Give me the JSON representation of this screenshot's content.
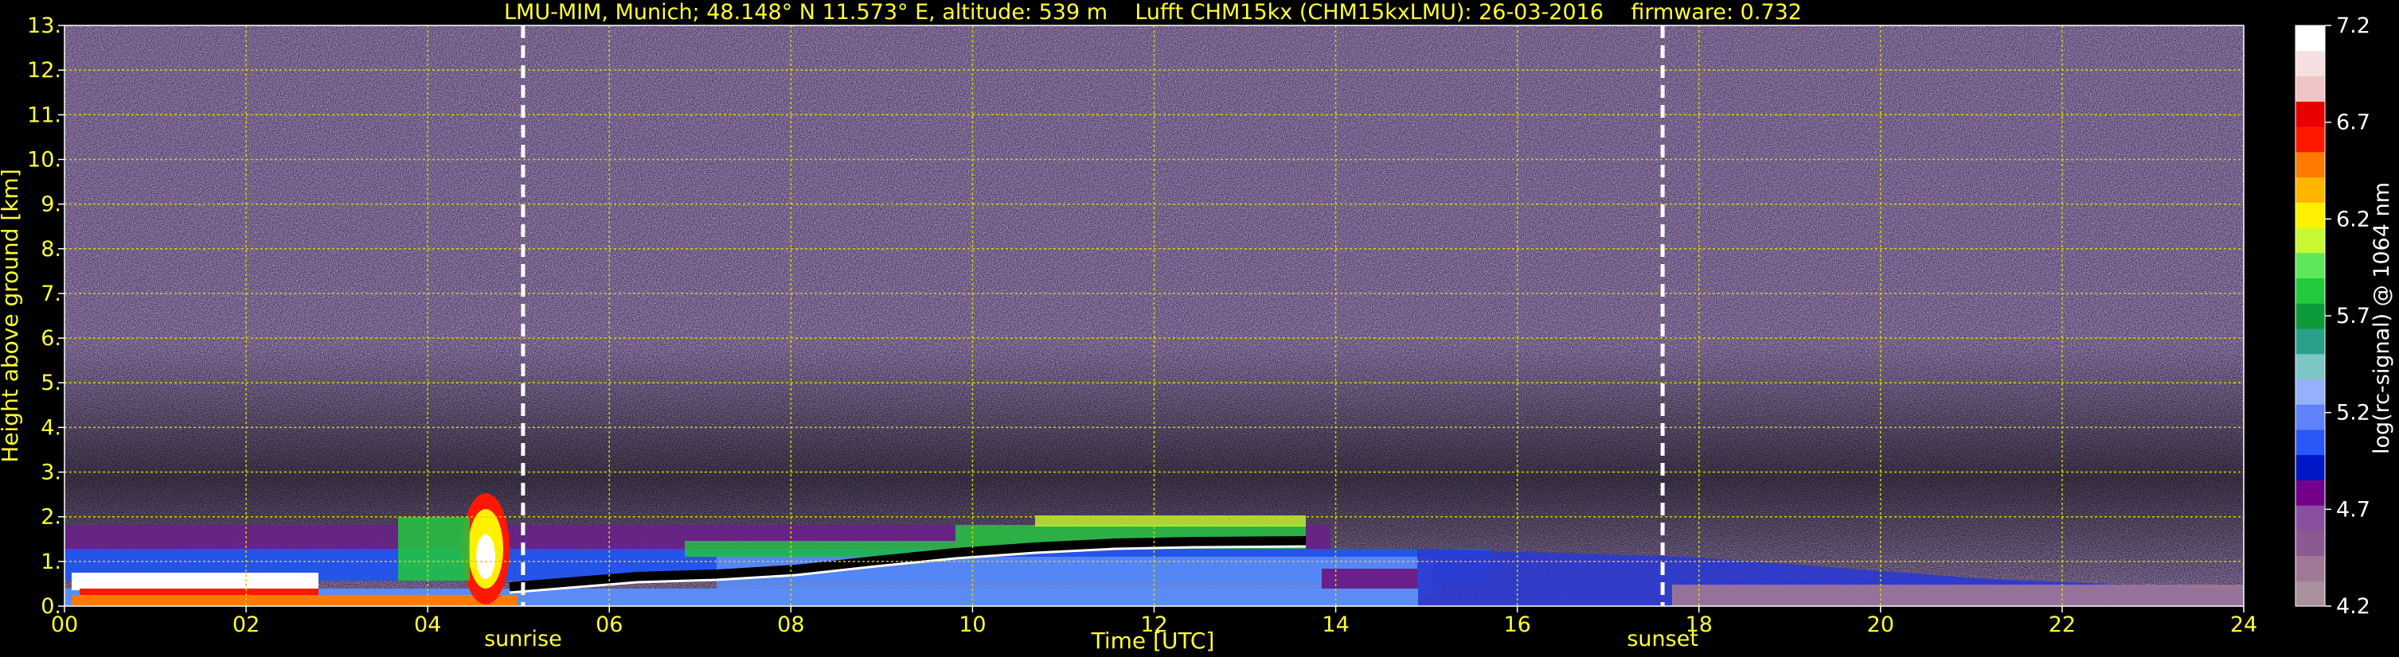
{
  "title": "LMU-MIM, Munich; 48.148° N 11.573° E, altitude: 539 m    Lufft CHM15kx (CHM15kxLMU): 26-03-2016    firmware: 0.732",
  "chart_data": {
    "type": "heatmap",
    "title": "LMU-MIM, Munich; 48.148° N 11.573° E, altitude: 539 m    Lufft CHM15kx (CHM15kxLMU): 26-03-2016    firmware: 0.732",
    "xlabel": "Time [UTC]",
    "ylabel": "Height above ground [km]",
    "xlim": [
      0,
      24
    ],
    "ylim": [
      0,
      13
    ],
    "x_ticks": [
      0,
      2,
      4,
      6,
      8,
      10,
      12,
      14,
      16,
      18,
      20,
      22,
      24
    ],
    "x_tick_labels": [
      "00",
      "02",
      "04",
      "06",
      "08",
      "10",
      "12",
      "14",
      "16",
      "18",
      "20",
      "22",
      "24"
    ],
    "y_ticks": [
      0,
      1,
      2,
      3,
      4,
      5,
      6,
      7,
      8,
      9,
      10,
      11,
      12,
      13
    ],
    "y_tick_labels": [
      "0.",
      "1.",
      "2.",
      "3.",
      "4.",
      "5.",
      "6.",
      "7.",
      "8.",
      "9.",
      "10.",
      "11.",
      "12.",
      "13."
    ],
    "grid": true,
    "annotations": [
      {
        "label": "sunrise",
        "x": 5.05
      },
      {
        "label": "sunset",
        "x": 17.6
      }
    ],
    "colorbar": {
      "label": "log(rc-signal) @ 1064 nm",
      "range": [
        4.2,
        7.2
      ],
      "ticks": [
        4.2,
        4.7,
        5.2,
        5.7,
        6.2,
        6.7,
        7.2
      ],
      "tick_labels": [
        "4.2",
        "4.7",
        "5.2",
        "5.7",
        "6.2",
        "6.7",
        "7.2"
      ],
      "colors": [
        "#a8909c",
        "#a07896",
        "#8a5a90",
        "#8b4fa0",
        "#75008a",
        "#0018c8",
        "#2858f8",
        "#5f82f8",
        "#95b1fb",
        "#7cc6c6",
        "#2aa08a",
        "#0d9a3a",
        "#22c93c",
        "#5de85b",
        "#c8f832",
        "#fff000",
        "#ffb400",
        "#ff7a00",
        "#ff1800",
        "#e80000",
        "#f0c4c4",
        "#f4e0e0",
        "#ffffff"
      ]
    },
    "features": [
      {
        "name": "aerosol layer",
        "x_range": [
          0,
          24
        ],
        "y_range": [
          0,
          1.8
        ]
      },
      {
        "name": "residual layer top",
        "x_range": [
          9.5,
          13.6
        ],
        "y": 1.6
      },
      {
        "name": "clouds",
        "x_range": [
          3.9,
          4.9
        ],
        "y_range": [
          0.3,
          2.7
        ]
      }
    ]
  }
}
